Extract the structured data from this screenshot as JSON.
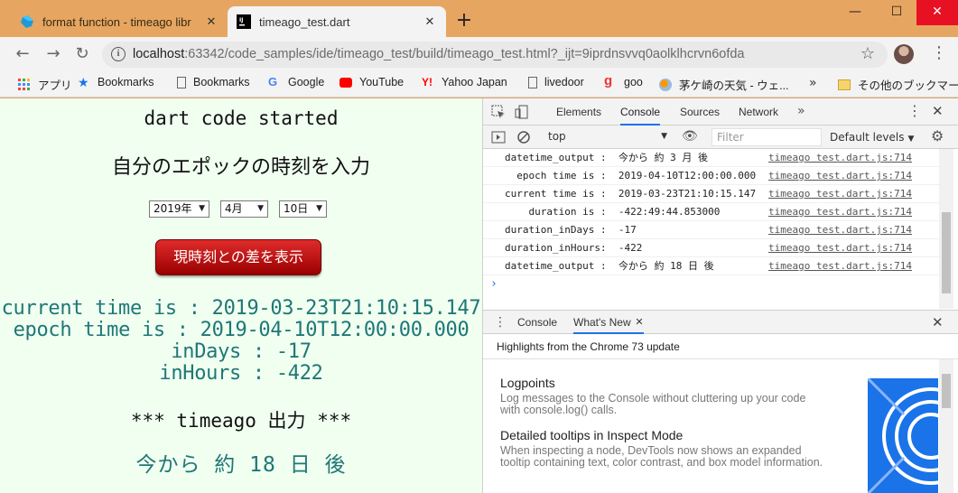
{
  "browser": {
    "tabs": [
      {
        "title": "format function - timeago libr",
        "active": false
      },
      {
        "title": "timeago_test.dart",
        "active": true
      }
    ],
    "url_host": "localhost",
    "url_rest": ":63342/code_samples/ide/timeago_test/build/timeago_test.html?_ijt=9iprdnsvvq0aolklhcrvn6ofda",
    "bookmarks": [
      {
        "label": "アプリ",
        "icon": "apps-grid-icon"
      },
      {
        "label": "Bookmarks",
        "icon": "star-icon"
      },
      {
        "label": "Bookmarks",
        "icon": "page-icon"
      },
      {
        "label": "Google",
        "icon": "google-icon"
      },
      {
        "label": "YouTube",
        "icon": "youtube-icon"
      },
      {
        "label": "Yahoo Japan",
        "icon": "yahoo-icon"
      },
      {
        "label": "livedoor",
        "icon": "page-icon"
      },
      {
        "label": "goo",
        "icon": "goo-icon"
      },
      {
        "label": "茅ケ崎の天気 - ウェ...",
        "icon": "weather-icon"
      }
    ],
    "bookmarks_overflow": "»",
    "other_bookmarks": "その他のブックマーク"
  },
  "page": {
    "title": "dart code started",
    "subtitle": "自分のエポックの時刻を入力",
    "select_year": "2019年",
    "select_month": "4月",
    "select_day": "10日",
    "button_label": "現時刻との差を表示",
    "current_time": "current time is : 2019-03-23T21:10:15.147",
    "epoch_time": "epoch time is : 2019-04-10T12:00:00.000",
    "in_days": "inDays : -17",
    "in_hours": "inHours : -422",
    "timeago_header": "*** timeago 出力 ***",
    "timeago_output": "今から 約 18 日 後"
  },
  "devtools": {
    "tabs": [
      "Elements",
      "Console",
      "Sources",
      "Network"
    ],
    "active_tab": "Console",
    "more": "»",
    "context": "top",
    "filter_placeholder": "Filter",
    "levels": "Default levels",
    "logs": [
      {
        "msg": "datetime_output :  今から 約 3 月 後",
        "src": "timeago test.dart.js:714"
      },
      {
        "msg": "  epoch time is :  2019-04-10T12:00:00.000",
        "src": "timeago test.dart.js:714"
      },
      {
        "msg": "current time is :  2019-03-23T21:10:15.147",
        "src": "timeago test.dart.js:714"
      },
      {
        "msg": "    duration is :  -422:49:44.853000",
        "src": "timeago test.dart.js:714"
      },
      {
        "msg": "duration_inDays :  -17",
        "src": "timeago test.dart.js:714"
      },
      {
        "msg": "duration_inHours:  -422",
        "src": "timeago test.dart.js:714"
      },
      {
        "msg": "datetime_output :  今から 約 18 日 後",
        "src": "timeago test.dart.js:714"
      }
    ],
    "prompt": "›",
    "drawer_tabs": [
      "Console",
      "What's New"
    ],
    "drawer_active": "What's New",
    "highlights": "Highlights from the Chrome 73 update",
    "features": [
      {
        "title": "Logpoints",
        "body": "Log messages to the Console without cluttering up your code with console.log() calls."
      },
      {
        "title": "Detailed tooltips in Inspect Mode",
        "body": "When inspecting a node, DevTools now shows an expanded tooltip containing text, color contrast, and box model information."
      }
    ]
  }
}
